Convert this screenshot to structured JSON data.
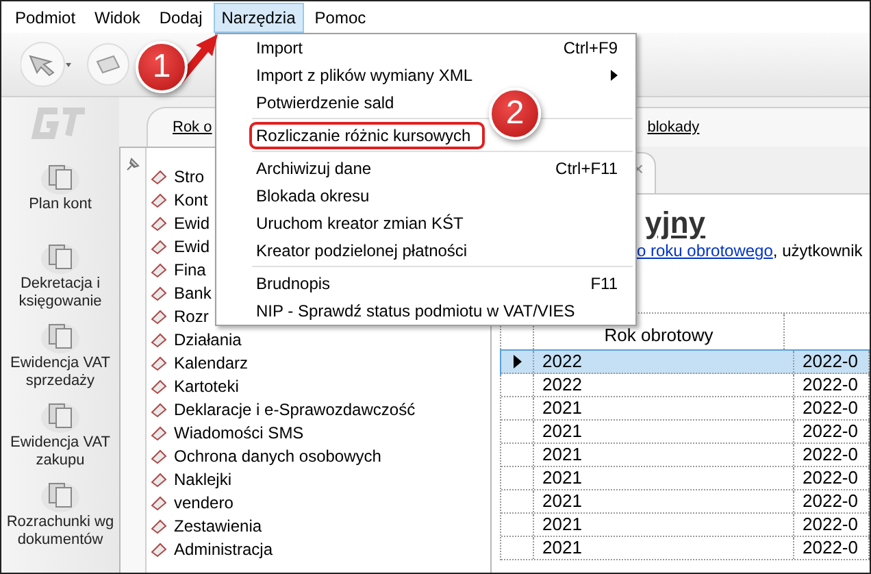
{
  "menu_bar": [
    {
      "label": "Podmiot",
      "selected": false
    },
    {
      "label": "Widok",
      "selected": false
    },
    {
      "label": "Dodaj",
      "selected": false
    },
    {
      "label": "Narzędzia",
      "selected": true
    },
    {
      "label": "Pomoc",
      "selected": false
    }
  ],
  "sidebar": {
    "items": [
      {
        "label": "Plan kont"
      },
      {
        "label": "Dekretacja i księgowanie"
      },
      {
        "label": "Ewidencja VAT sprzedaży"
      },
      {
        "label": "Ewidencja VAT zakupu"
      },
      {
        "label": "Rozrachunki wg dokumentów"
      }
    ]
  },
  "link_bar": {
    "links": [
      "Rok o",
      "blokady"
    ]
  },
  "tree": {
    "items": [
      {
        "label": "Stro"
      },
      {
        "label": "Kont"
      },
      {
        "label": "Ewid"
      },
      {
        "label": "Ewid"
      },
      {
        "label": "Fina"
      },
      {
        "label": "Bank"
      },
      {
        "label": "Rozr"
      },
      {
        "label": "Działania"
      },
      {
        "label": "Kalendarz"
      },
      {
        "label": "Kartoteki"
      },
      {
        "label": "Deklaracje i e-Sprawozdawczość"
      },
      {
        "label": "Wiadomości SMS"
      },
      {
        "label": "Ochrona danych osobowych"
      },
      {
        "label": "Naklejki"
      },
      {
        "label": "vendero"
      },
      {
        "label": "Zestawienia"
      },
      {
        "label": "Administracja"
      }
    ]
  },
  "document": {
    "tab_close": "×",
    "title": "yjny",
    "link": "o roku obrotowego",
    "text": ", użytkownik"
  },
  "table": {
    "columns": [
      "Rok obrotowy"
    ],
    "rows": [
      {
        "selected": true,
        "cells": [
          "2022",
          "2022-0"
        ]
      },
      {
        "selected": false,
        "cells": [
          "2022",
          "2022-0"
        ]
      },
      {
        "selected": false,
        "cells": [
          "2021",
          "2022-0"
        ]
      },
      {
        "selected": false,
        "cells": [
          "2021",
          "2022-0"
        ]
      },
      {
        "selected": false,
        "cells": [
          "2021",
          "2022-0"
        ]
      },
      {
        "selected": false,
        "cells": [
          "2021",
          "2022-0"
        ]
      },
      {
        "selected": false,
        "cells": [
          "2021",
          "2022-0"
        ]
      },
      {
        "selected": false,
        "cells": [
          "2021",
          "2022-0"
        ]
      },
      {
        "selected": false,
        "cells": [
          "2021",
          "2022-0"
        ]
      }
    ]
  },
  "dropdown_menu": {
    "items": [
      {
        "kind": "item",
        "label": "Import",
        "shortcut": "Ctrl+F9",
        "highlighted": false
      },
      {
        "kind": "submenu",
        "label": "Import z plików wymiany XML",
        "highlighted": false
      },
      {
        "kind": "item",
        "label": "Potwierdzenie sald",
        "highlighted": false
      },
      {
        "kind": "separator"
      },
      {
        "kind": "item",
        "label": "Rozliczanie różnic kursowych",
        "highlighted": true
      },
      {
        "kind": "separator"
      },
      {
        "kind": "item",
        "label": "Archiwizuj dane",
        "shortcut": "Ctrl+F11",
        "highlighted": false
      },
      {
        "kind": "item",
        "label": "Blokada okresu",
        "highlighted": false
      },
      {
        "kind": "item",
        "label": "Uruchom kreator zmian KŚT",
        "highlighted": false
      },
      {
        "kind": "item",
        "label": "Kreator podzielonej płatności",
        "highlighted": false
      },
      {
        "kind": "separator"
      },
      {
        "kind": "item",
        "label": "Brudnopis",
        "shortcut": "F11",
        "highlighted": false
      },
      {
        "kind": "item",
        "label": "NIP - Sprawdź status podmiotu w VAT/VIES",
        "highlighted": false
      }
    ]
  },
  "callouts": [
    "1",
    "2"
  ]
}
